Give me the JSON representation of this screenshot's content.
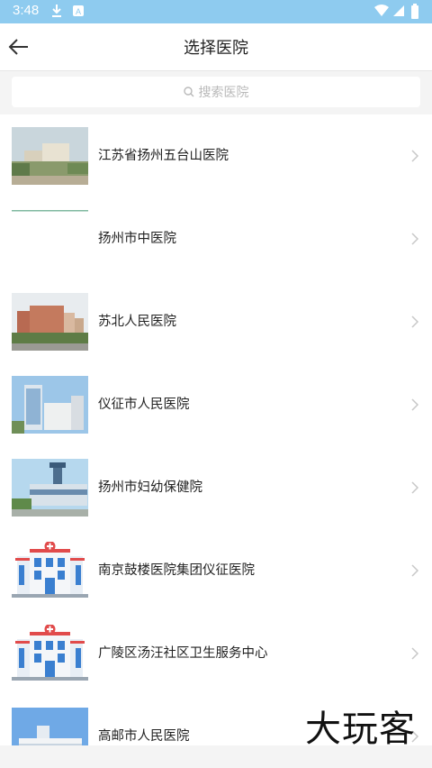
{
  "status_bar": {
    "time": "3:48"
  },
  "header": {
    "title": "选择医院"
  },
  "search": {
    "placeholder": "搜索医院"
  },
  "hospitals": [
    {
      "name": "江苏省扬州五台山医院",
      "image": "photo"
    },
    {
      "name": "扬州市中医院",
      "image": "blank"
    },
    {
      "name": "苏北人民医院",
      "image": "photo"
    },
    {
      "name": "仪征市人民医院",
      "image": "photo"
    },
    {
      "name": "扬州市妇幼保健院",
      "image": "photo"
    },
    {
      "name": "南京鼓楼医院集团仪征医院",
      "image": "hospital-icon"
    },
    {
      "name": "广陵区汤汪社区卫生服务中心",
      "image": "hospital-icon"
    },
    {
      "name": "高邮市人民医院",
      "image": "photo"
    }
  ],
  "watermark": "大玩客",
  "colors": {
    "status_bar": "#8ecbef",
    "chevron": "#c8c8c8",
    "icon_red": "#e14b4b",
    "icon_blue": "#3a7fd0"
  }
}
